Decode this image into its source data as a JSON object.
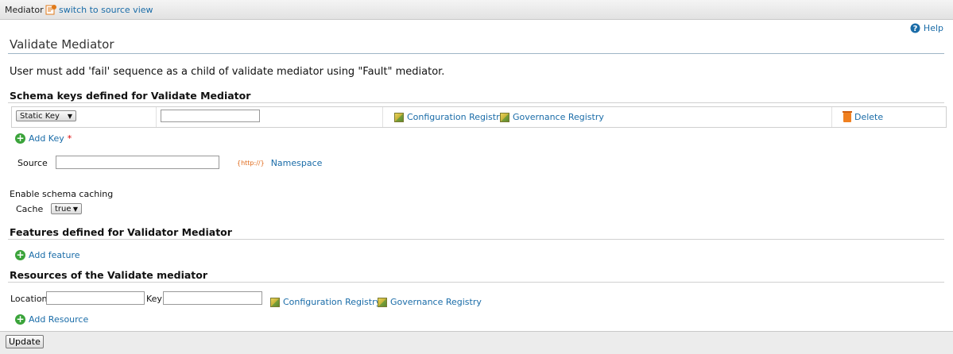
{
  "topbar": {
    "title": "Mediator",
    "source_link": "switch to source view"
  },
  "help": "Help",
  "heading": "Validate Mediator",
  "note": "User must add 'fail' sequence as a child of validate mediator using \"Fault\" mediator.",
  "schema": {
    "title": "Schema keys defined for Validate Mediator",
    "key_type": "Static Key",
    "key_value": "",
    "config_registry": "Configuration Registry",
    "gov_registry": "Governance Registry",
    "delete": "Delete",
    "add_key": "Add Key",
    "required_mark": "*",
    "source_label": "Source",
    "source_value": "",
    "namespace": "Namespace",
    "namespace_icon_text": "{http://}"
  },
  "caching": {
    "title": "Enable schema caching",
    "label": "Cache",
    "value": "true"
  },
  "features": {
    "title": "Features defined for Validator Mediator",
    "add": "Add feature"
  },
  "resources": {
    "title": "Resources of the Validate mediator",
    "location_label": "Location",
    "location_value": "",
    "key_label": "Key",
    "key_value": "",
    "config_registry": "Configuration Registry",
    "gov_registry": "Governance Registry",
    "add": "Add Resource"
  },
  "update_button": "Update"
}
